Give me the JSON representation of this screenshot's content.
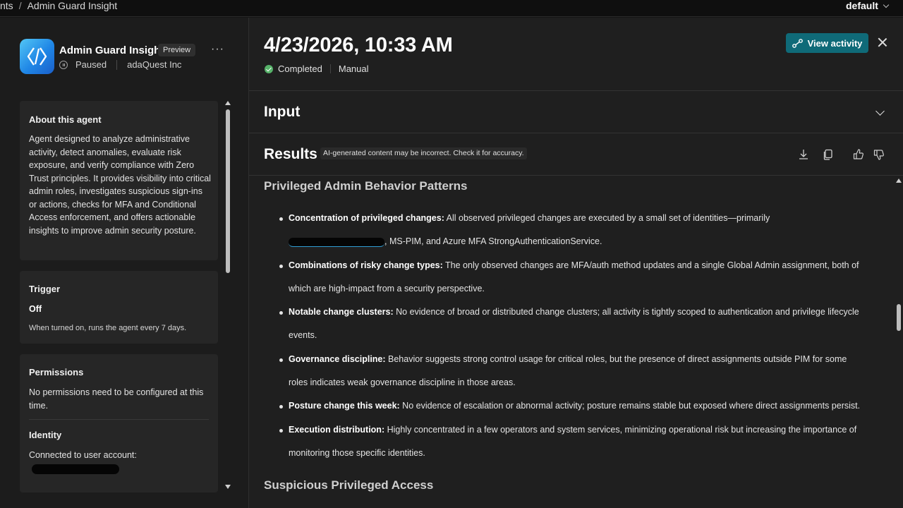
{
  "topbar": {
    "breadcrumb": [
      "nts",
      "Admin Guard Insight"
    ],
    "environment": "default"
  },
  "agent": {
    "name": "Admin Guard Insight",
    "badge": "Preview",
    "more": "···",
    "status": "Paused",
    "org": "adaQuest Inc"
  },
  "about": {
    "title": "About this agent",
    "description": "Agent designed to analyze administrative activity, detect anomalies, evaluate risk exposure, and verify compliance with Zero Trust principles. It provides visibility into critical admin roles, investigates suspicious sign-ins or actions, checks for MFA and Conditional Access enforcement, and offers actionable insights to improve admin security posture."
  },
  "trigger": {
    "title": "Trigger",
    "state": "Off",
    "description": "When turned on, runs the agent every 7 days."
  },
  "permissions": {
    "title": "Permissions",
    "description": "No permissions need to be configured at this time."
  },
  "identity": {
    "title": "Identity",
    "description": "Connected to user account:"
  },
  "run": {
    "title": "4/23/2026, 10:33 AM",
    "status": "Completed",
    "mode": "Manual",
    "view_activity": "View activity"
  },
  "input": {
    "title": "Input"
  },
  "results": {
    "title": "Results",
    "ai_note": "AI-generated content may be incorrect. Check it for accuracy.",
    "tools": [
      "download-icon",
      "copy-icon",
      "thumbs-up-icon",
      "thumbs-down-icon"
    ]
  },
  "report": {
    "section1": "Privileged Admin Behavior Patterns",
    "bullets": [
      {
        "label": "Concentration of privileged changes:",
        "text": " All observed privileged changes are executed by a small set of identities—primarily ",
        "text_after": ", MS-PIM, and Azure MFA StrongAuthenticationService."
      },
      {
        "label": "Combinations of risky change types:",
        "text": " The only observed changes are MFA/auth method updates and a single Global Admin assignment, both of which are high-impact from a security perspective."
      },
      {
        "label": "Notable change clusters:",
        "text": " No evidence of broad or distributed change clusters; all activity is tightly scoped to authentication and privilege lifecycle events."
      },
      {
        "label": "Governance discipline:",
        "text": " Behavior suggests strong control usage for critical roles, but the presence of direct assignments outside PIM for some roles indicates weak governance discipline in those areas."
      },
      {
        "label": "Posture change this week:",
        "text": " No evidence of escalation or abnormal activity; posture remains stable but exposed where direct assignments persist."
      },
      {
        "label": "Execution distribution:",
        "text": " Highly concentrated in a few operators and system services, minimizing operational risk but increasing the importance of monitoring those specific identities."
      }
    ],
    "section2": "Suspicious Privileged Access"
  },
  "colors": {
    "accent_button": "#0f6a78",
    "success": "#57b36a",
    "link": "#2f9fd6"
  }
}
